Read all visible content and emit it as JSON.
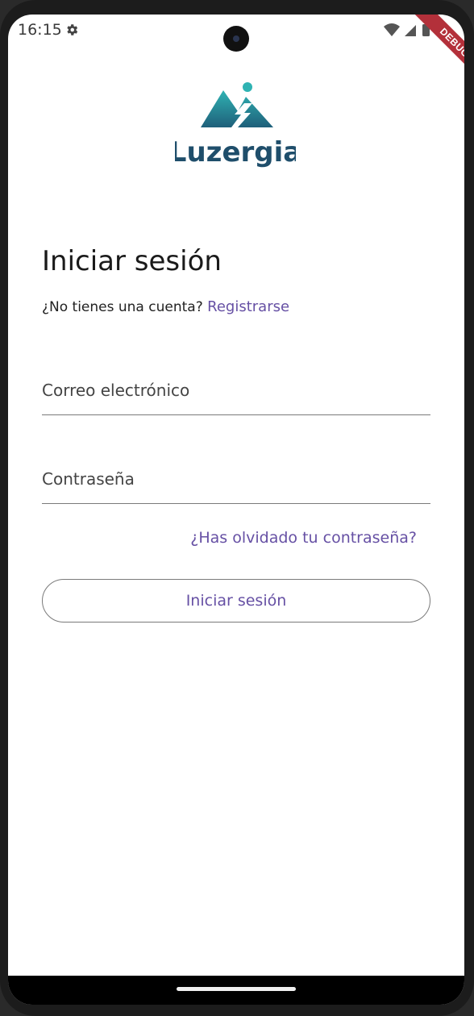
{
  "status_bar": {
    "time": "16:15",
    "settings_icon": "gear-icon",
    "wifi_icon": "wifi-icon",
    "signal_icon": "signal-icon",
    "battery_icon": "battery-icon"
  },
  "debug_banner": "DEBUG",
  "brand": {
    "name": "Luzergia",
    "colors": {
      "primary": "#1f4e6b",
      "teal": "#2fb3b3"
    }
  },
  "login": {
    "title": "Iniciar sesión",
    "no_account_text": "¿No tienes una cuenta?",
    "register_link": "Registrarse",
    "email_placeholder": "Correo electrónico",
    "password_placeholder": "Contraseña",
    "forgot_password": "¿Has olvidado tu contraseña?",
    "submit_label": "Iniciar sesión"
  },
  "theme": {
    "accent": "#6650a4",
    "underline": "#7a7a7a"
  }
}
